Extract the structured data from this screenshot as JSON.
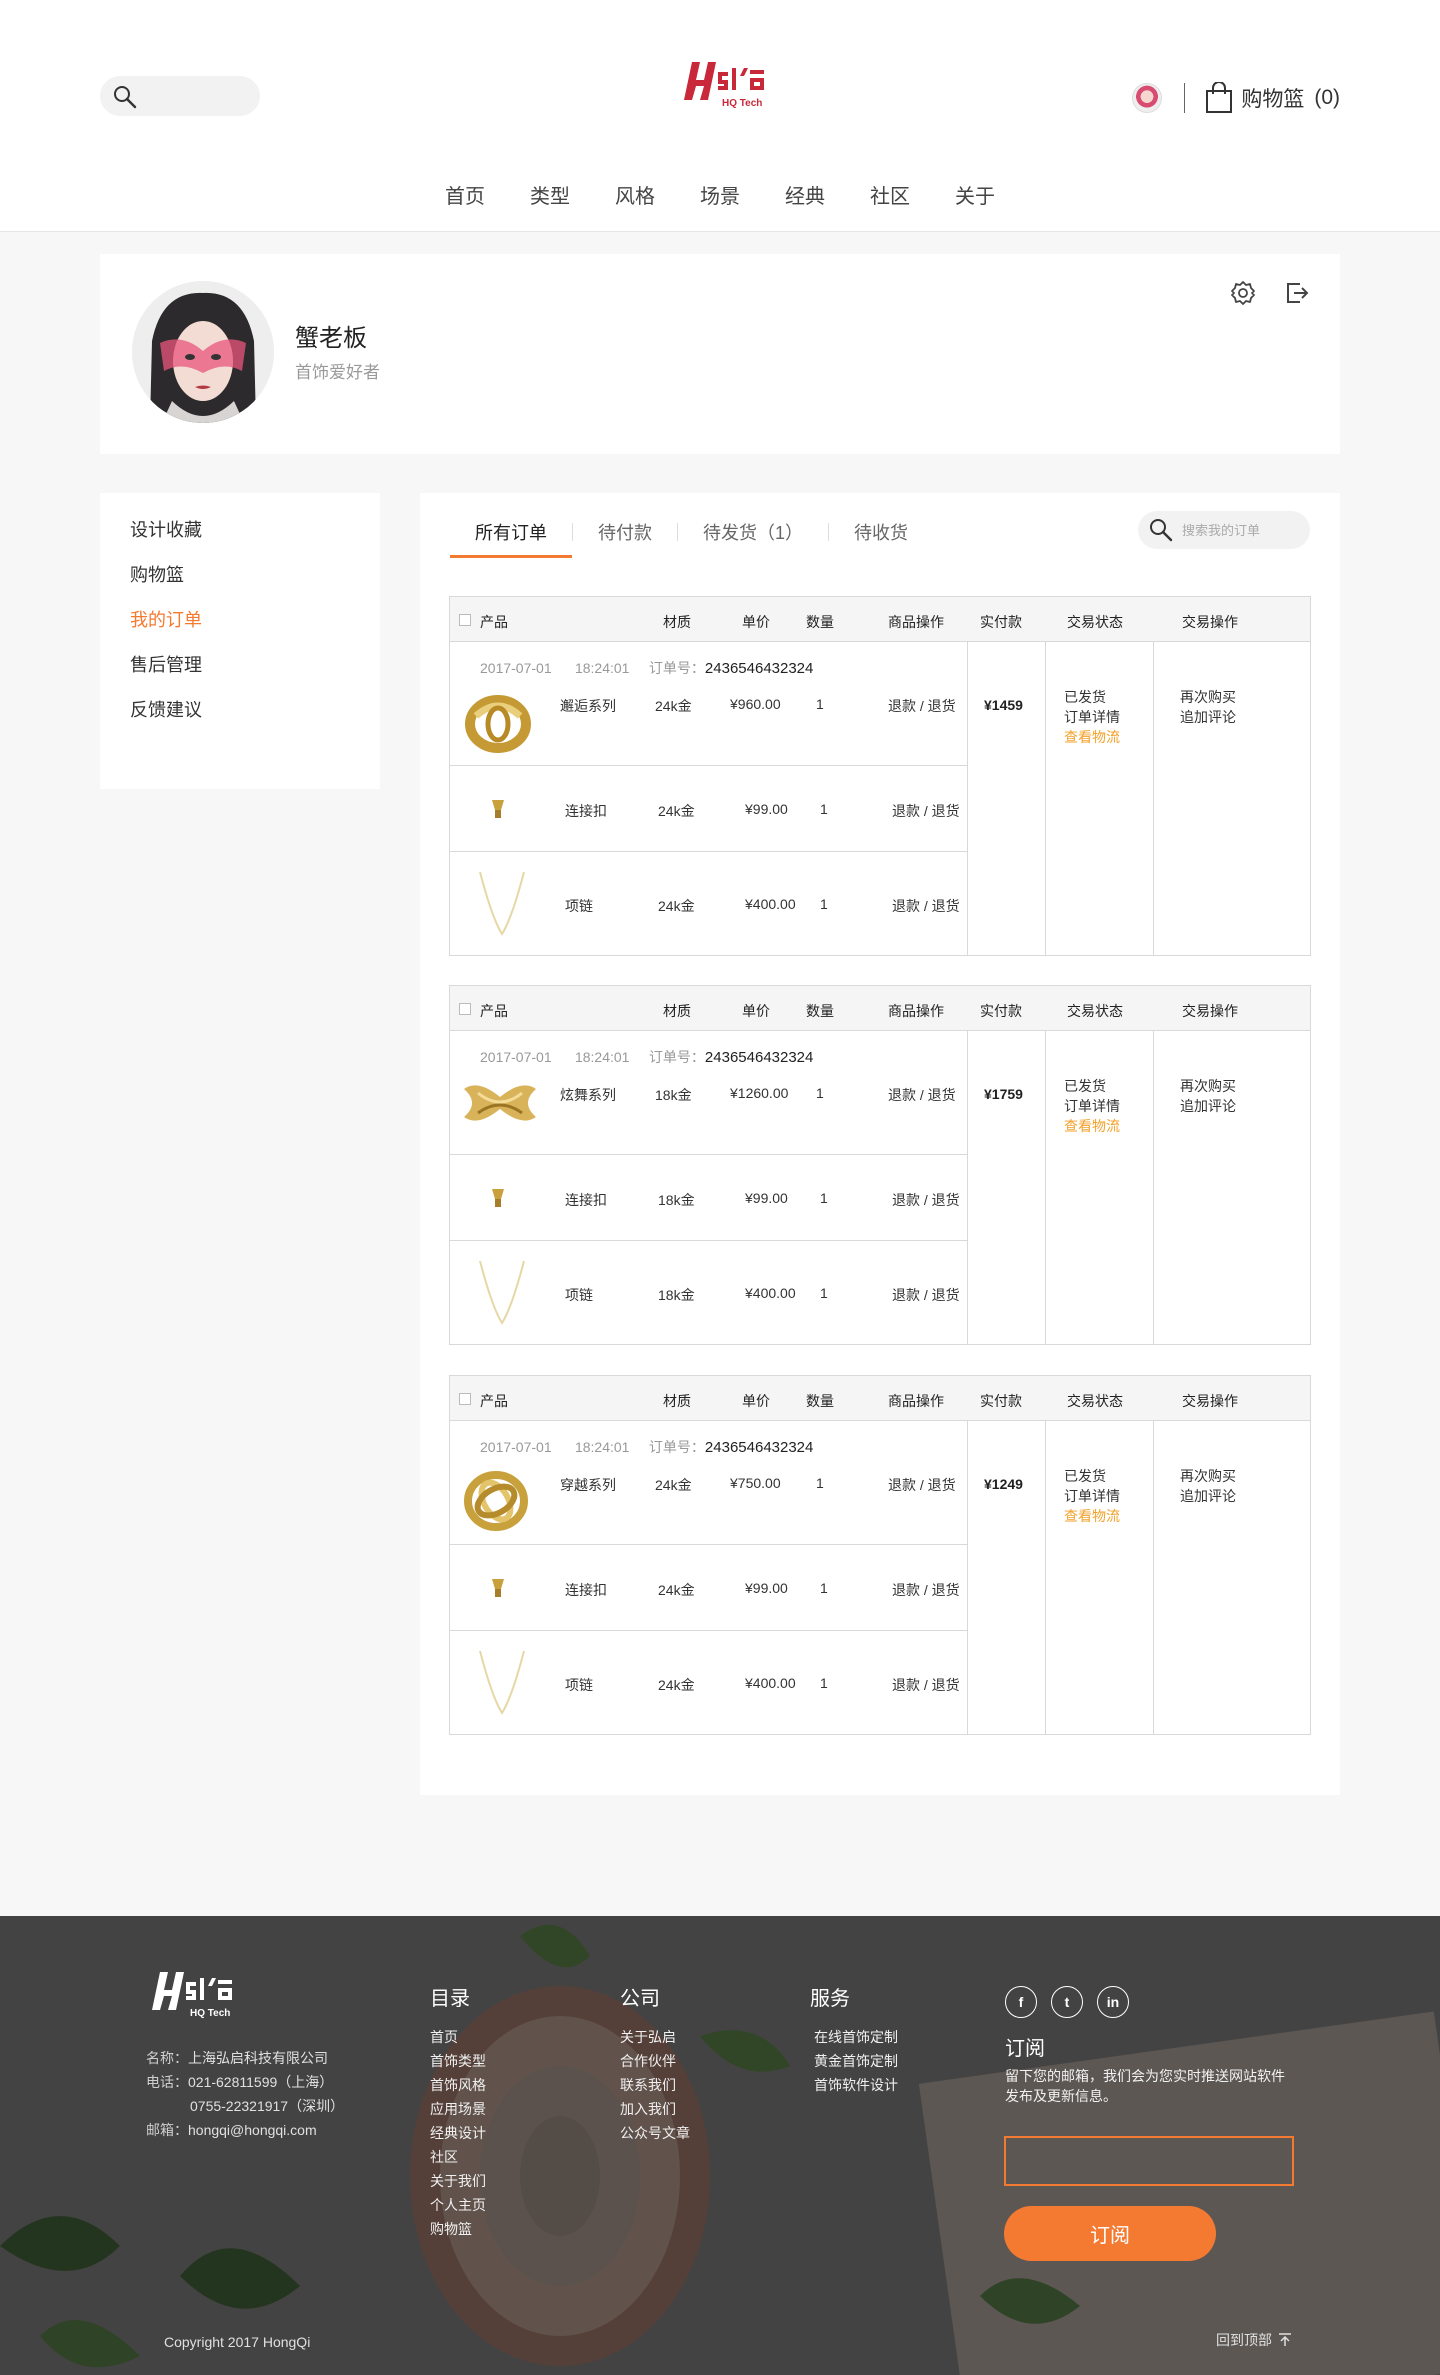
{
  "brand": {
    "name_cn": "弘启",
    "name_en": "HQ Tech",
    "accent": "#f47a32",
    "track_color": "#f4a12a"
  },
  "header": {
    "cart_label": "购物篮",
    "cart_count": "(0)",
    "nav": [
      "首页",
      "类型",
      "风格",
      "场景",
      "经典",
      "社区",
      "关于"
    ]
  },
  "profile": {
    "name": "蟹老板",
    "tagline": "首饰爱好者"
  },
  "sidebar": {
    "items": [
      {
        "label": "设计收藏"
      },
      {
        "label": "购物篮"
      },
      {
        "label": "我的订单",
        "active": true
      },
      {
        "label": "售后管理"
      },
      {
        "label": "反馈建议"
      }
    ]
  },
  "orders": {
    "tabs": [
      "所有订单",
      "待付款",
      "待发货（1）",
      "待收货"
    ],
    "search_placeholder": "搜索我的订单",
    "headers": {
      "product": "产品",
      "material": "材质",
      "price": "单价",
      "qty": "数量",
      "item_ops": "商品操作",
      "paid": "实付款",
      "status": "交易状态",
      "trade_ops": "交易操作"
    },
    "list": [
      {
        "date": "2017-07-01",
        "time": "18:24:01",
        "order_no_label": "订单号：",
        "order_no": "2436546432324",
        "paid": "¥1459",
        "status": [
          "已发货",
          "订单详情",
          "查看物流"
        ],
        "ops": [
          "再次购买",
          "追加评论"
        ],
        "items": [
          {
            "name": "邂逅系列",
            "material": "24k金",
            "price": "¥960.00",
            "qty": "1",
            "op": "退款 / 退货"
          },
          {
            "name": "连接扣",
            "material": "24k金",
            "price": "¥99.00",
            "qty": "1",
            "op": "退款 / 退货"
          },
          {
            "name": "项链",
            "material": "24k金",
            "price": "¥400.00",
            "qty": "1",
            "op": "退款 / 退货"
          }
        ]
      },
      {
        "date": "2017-07-01",
        "time": "18:24:01",
        "order_no_label": "订单号：",
        "order_no": "2436546432324",
        "paid": "¥1759",
        "status": [
          "已发货",
          "订单详情",
          "查看物流"
        ],
        "ops": [
          "再次购买",
          "追加评论"
        ],
        "items": [
          {
            "name": "炫舞系列",
            "material": "18k金",
            "price": "¥1260.00",
            "qty": "1",
            "op": "退款 / 退货"
          },
          {
            "name": "连接扣",
            "material": "18k金",
            "price": "¥99.00",
            "qty": "1",
            "op": "退款 / 退货"
          },
          {
            "name": "项链",
            "material": "18k金",
            "price": "¥400.00",
            "qty": "1",
            "op": "退款 / 退货"
          }
        ]
      },
      {
        "date": "2017-07-01",
        "time": "18:24:01",
        "order_no_label": "订单号：",
        "order_no": "2436546432324",
        "paid": "¥1249",
        "status": [
          "已发货",
          "订单详情",
          "查看物流"
        ],
        "ops": [
          "再次购买",
          "追加评论"
        ],
        "items": [
          {
            "name": "穿越系列",
            "material": "24k金",
            "price": "¥750.00",
            "qty": "1",
            "op": "退款 / 退货"
          },
          {
            "name": "连接扣",
            "material": "24k金",
            "price": "¥99.00",
            "qty": "1",
            "op": "退款 / 退货"
          },
          {
            "name": "项链",
            "material": "24k金",
            "price": "¥400.00",
            "qty": "1",
            "op": "退款 / 退货"
          }
        ]
      }
    ]
  },
  "footer": {
    "company": {
      "name_label": "名称：",
      "name": "上海弘启科技有限公司",
      "phone_label": "电话：",
      "phone1": "021-62811599（上海）",
      "phone2": "0755-22321917（深圳）",
      "email_label": "邮箱：",
      "email": "hongqi@hongqi.com"
    },
    "catalog": {
      "title": "目录",
      "links": [
        "首页",
        "首饰类型",
        "首饰风格",
        "应用场景",
        "经典设计",
        "社区",
        "关于我们",
        "个人主页",
        "购物篮"
      ]
    },
    "company_col": {
      "title": "公司",
      "links": [
        "关于弘启",
        "合作伙伴",
        "联系我们",
        "加入我们",
        "公众号文章"
      ]
    },
    "service": {
      "title": "服务",
      "links": [
        "在线首饰定制",
        "黄金首饰定制",
        "首饰软件设计"
      ]
    },
    "subscribe": {
      "title": "订阅",
      "desc": "留下您的邮箱，我们会为您实时推送网站软件发布及更新信息。",
      "input_value": "",
      "button": "订阅"
    },
    "social": [
      "f",
      "t",
      "in"
    ],
    "copyright": "Copyright 2017 HongQi",
    "back_top": "回到顶部"
  }
}
